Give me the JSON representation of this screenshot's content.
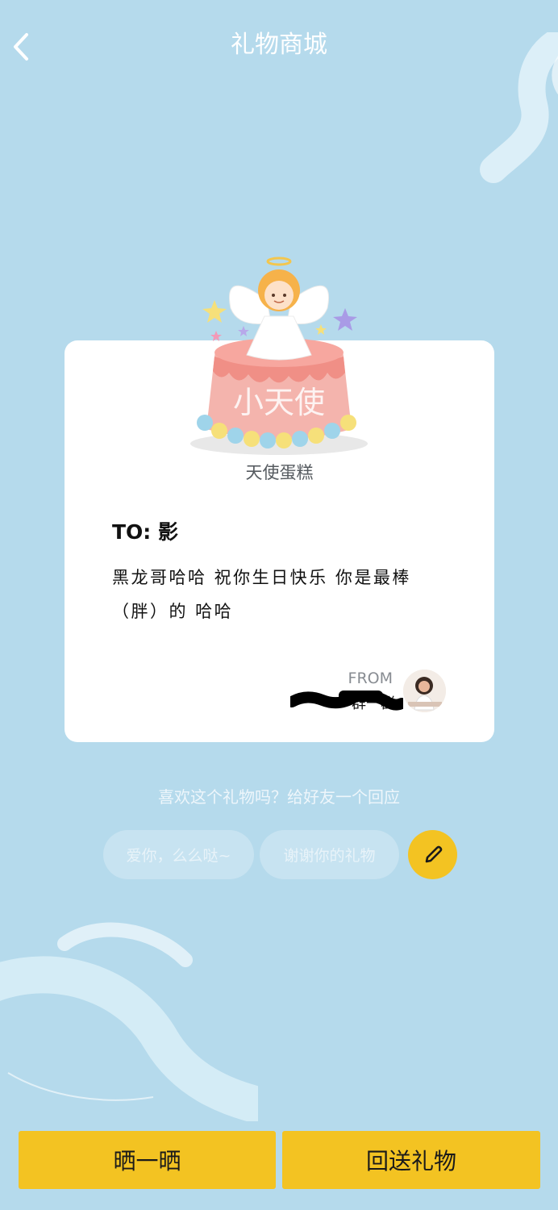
{
  "header": {
    "title": "礼物商城",
    "back_icon": "chevron-left-icon"
  },
  "gift": {
    "name": "天使蛋糕",
    "image_text": "小天使",
    "image_icon": "angel-cake-icon"
  },
  "card": {
    "to_line": "TO: 影",
    "message": "黑龙哥哈哈 祝你生日快乐 你是最棒（胖）的 哈哈",
    "from_label": "FROM",
    "sender_name": "一群一群"
  },
  "response": {
    "prompt": "喜欢这个礼物吗？给好友一个回应",
    "quick_replies": [
      "爱你，么么哒~",
      "谢谢你的礼物"
    ],
    "edit_icon": "pencil-icon"
  },
  "actions": {
    "share_label": "晒一晒",
    "return_gift_label": "回送礼物"
  },
  "colors": {
    "background": "#b5daec",
    "accent": "#f3c322",
    "card": "#ffffff"
  }
}
